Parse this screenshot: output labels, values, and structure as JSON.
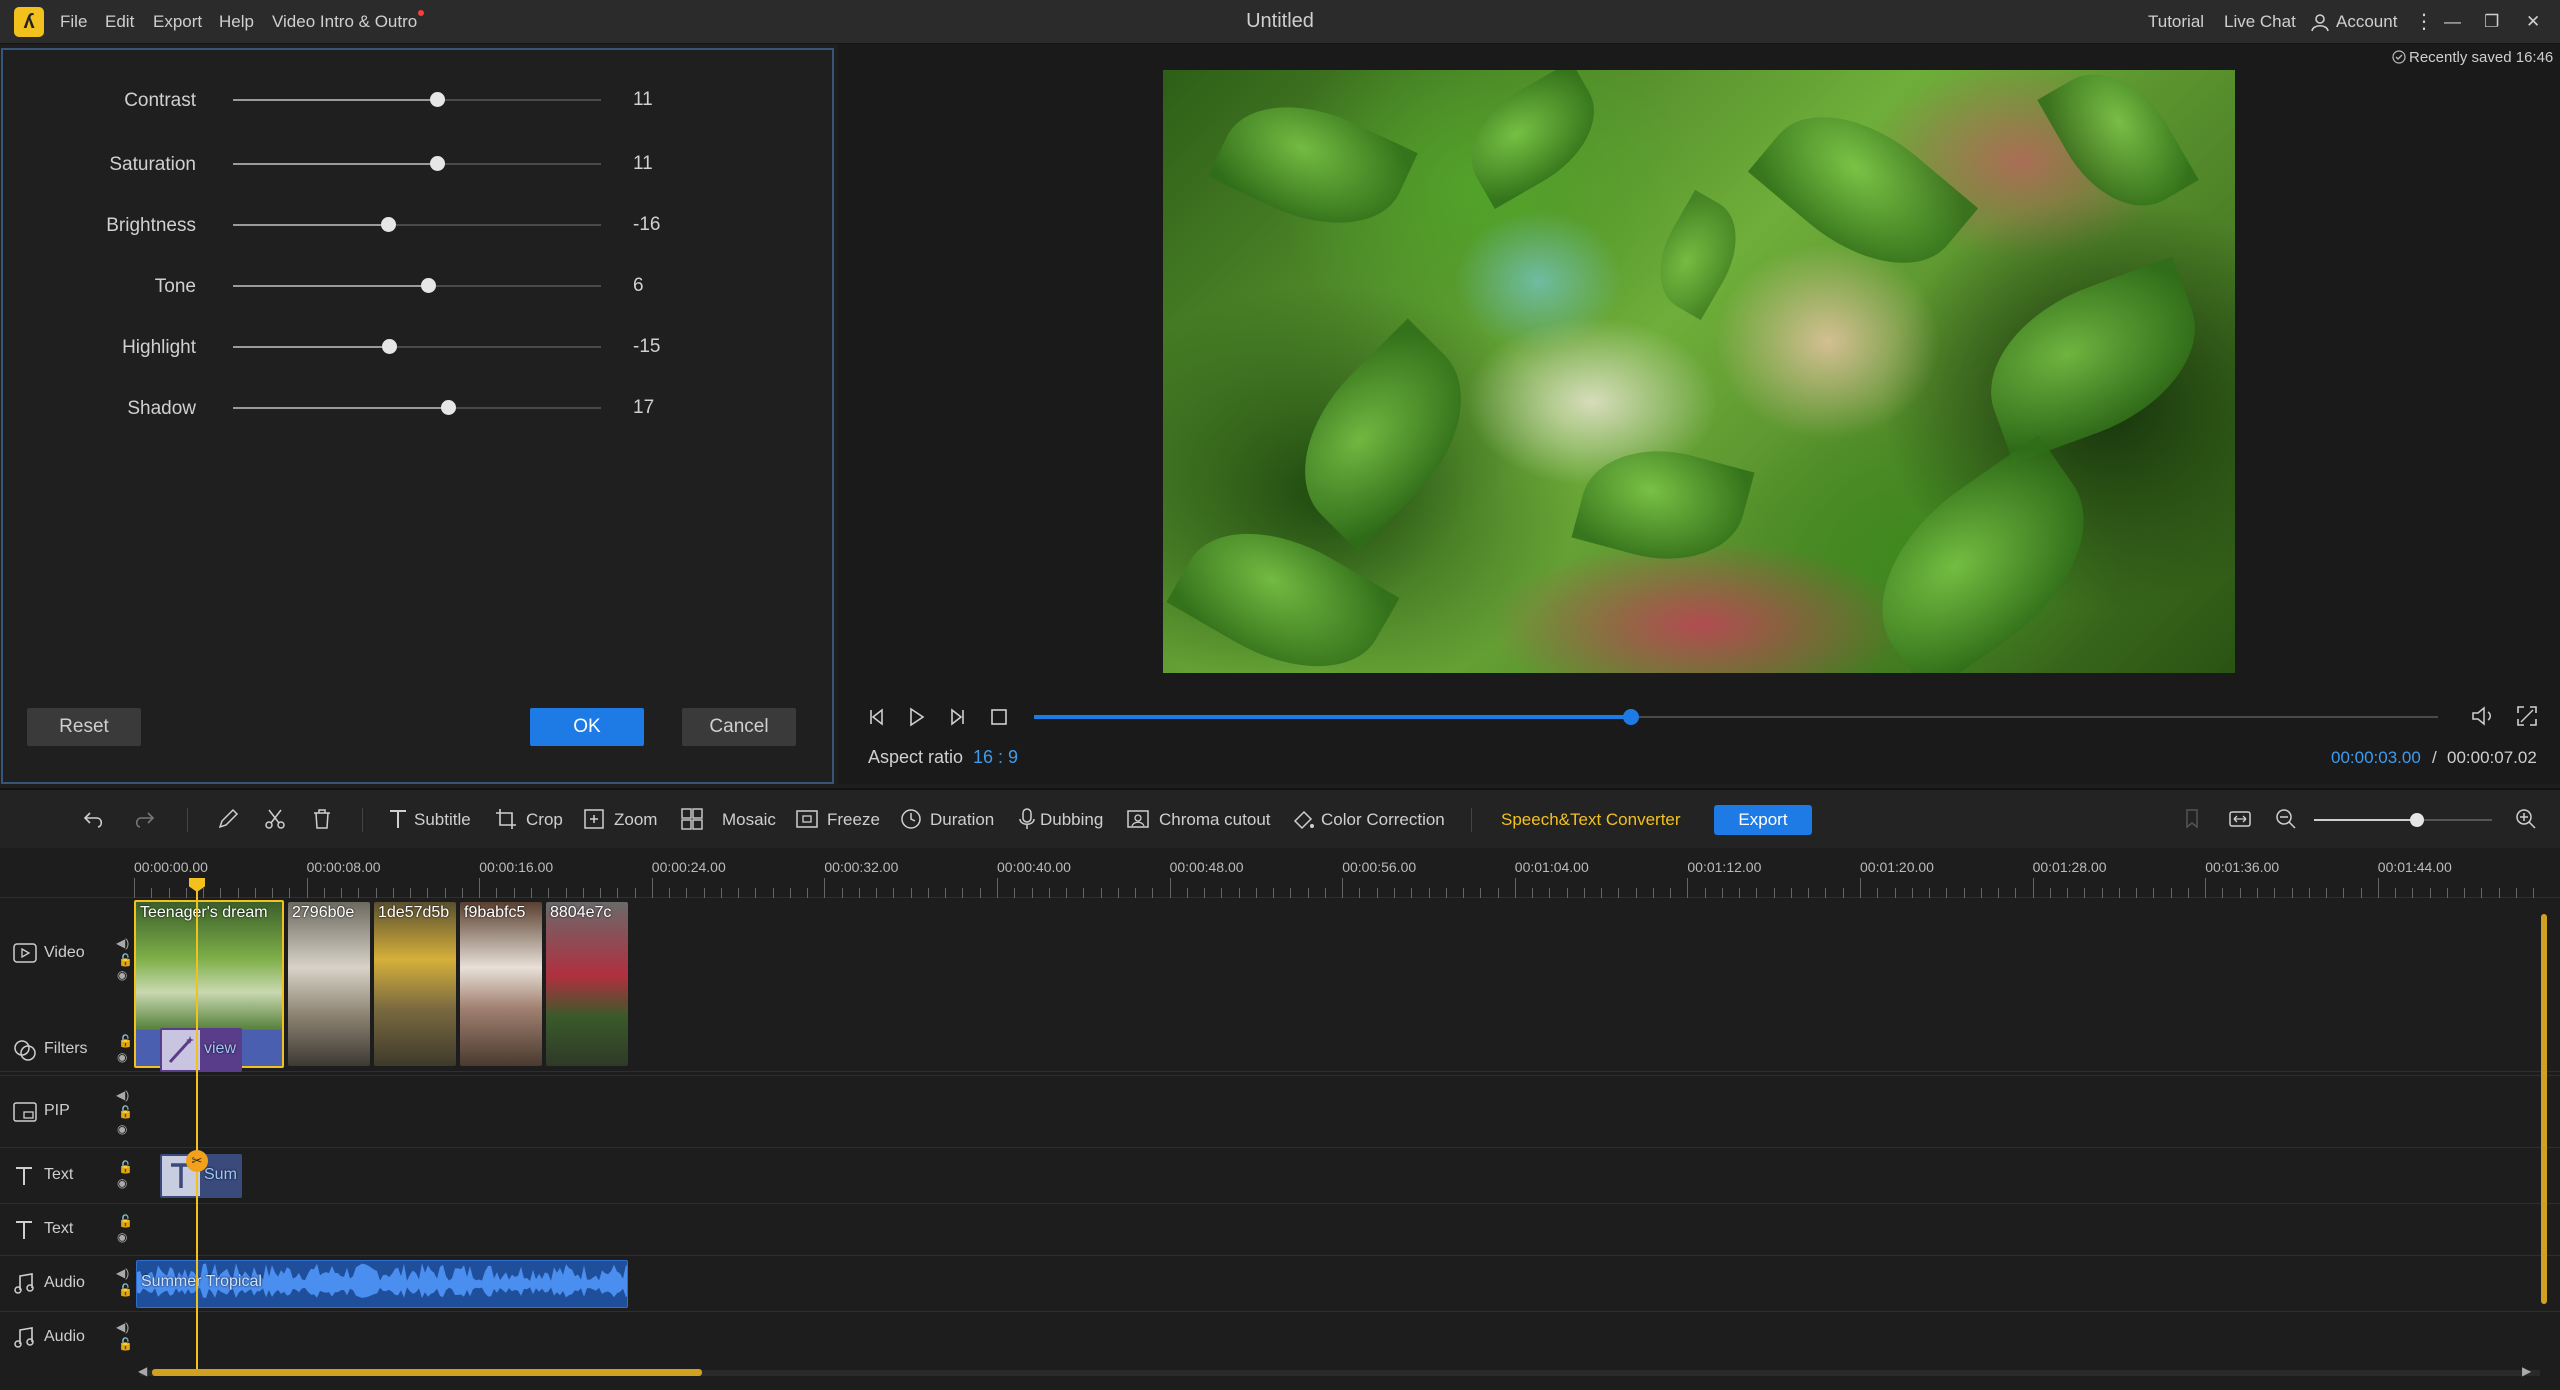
{
  "titlebar": {
    "logo_glyph": "ʎ",
    "menu": [
      "File",
      "Edit",
      "Export",
      "Help",
      "Video Intro & Outro"
    ],
    "title": "Untitled",
    "right": [
      "Tutorial",
      "Live Chat",
      "Account"
    ],
    "window_buttons": [
      "—",
      "❐",
      "✕"
    ]
  },
  "adjust_panel": {
    "sliders": [
      {
        "label": "Contrast",
        "value": "11",
        "level": 0.555
      },
      {
        "label": "Saturation",
        "value": "11",
        "level": 0.555
      },
      {
        "label": "Brightness",
        "value": "-16",
        "level": 0.42
      },
      {
        "label": "Tone",
        "value": "6",
        "level": 0.53
      },
      {
        "label": "Highlight",
        "value": "-15",
        "level": 0.425
      },
      {
        "label": "Shadow",
        "value": "17",
        "level": 0.585
      }
    ],
    "reset_label": "Reset",
    "ok_label": "OK",
    "cancel_label": "Cancel"
  },
  "preview": {
    "saved_status": "Recently saved 16:46",
    "aspect_label": "Aspect ratio",
    "aspect_value": "16 : 9",
    "current_time": "00:00:03.00",
    "separator": "/",
    "total_time": "00:00:07.02",
    "progress": 0.425
  },
  "toolbar": {
    "items": [
      "Subtitle",
      "Crop",
      "Zoom",
      "Mosaic",
      "Freeze",
      "Duration",
      "Dubbing",
      "Chroma cutout",
      "Color Correction"
    ],
    "speech_label": "Speech&Text Converter",
    "export_label": "Export",
    "zoom_level": 0.58
  },
  "ruler": {
    "labels": [
      "00:00:00.00",
      "00:00:08.00",
      "00:00:16.00",
      "00:00:24.00",
      "00:00:32.00",
      "00:00:40.00",
      "00:00:48.00",
      "00:00:56.00",
      "00:01:04.00",
      "00:01:12.00",
      "00:01:20.00",
      "00:01:28.00",
      "00:01:36.00",
      "00:01:44.00"
    ]
  },
  "tracks": {
    "labels": [
      "Video",
      "Filters",
      "PIP",
      "Text",
      "Text",
      "Audio",
      "Audio"
    ],
    "video_clips": [
      "Teenager's dream",
      "2796b0e",
      "1de57d5b",
      "f9babfc5",
      "8804e7c"
    ],
    "filter_clip": "view",
    "text_clip": "Sum",
    "audio_clip": "Summer Tropical"
  },
  "colors": {
    "accent": "#1e7be6",
    "highlight": "#f2c11d",
    "time_blue": "#3d9cf0"
  }
}
